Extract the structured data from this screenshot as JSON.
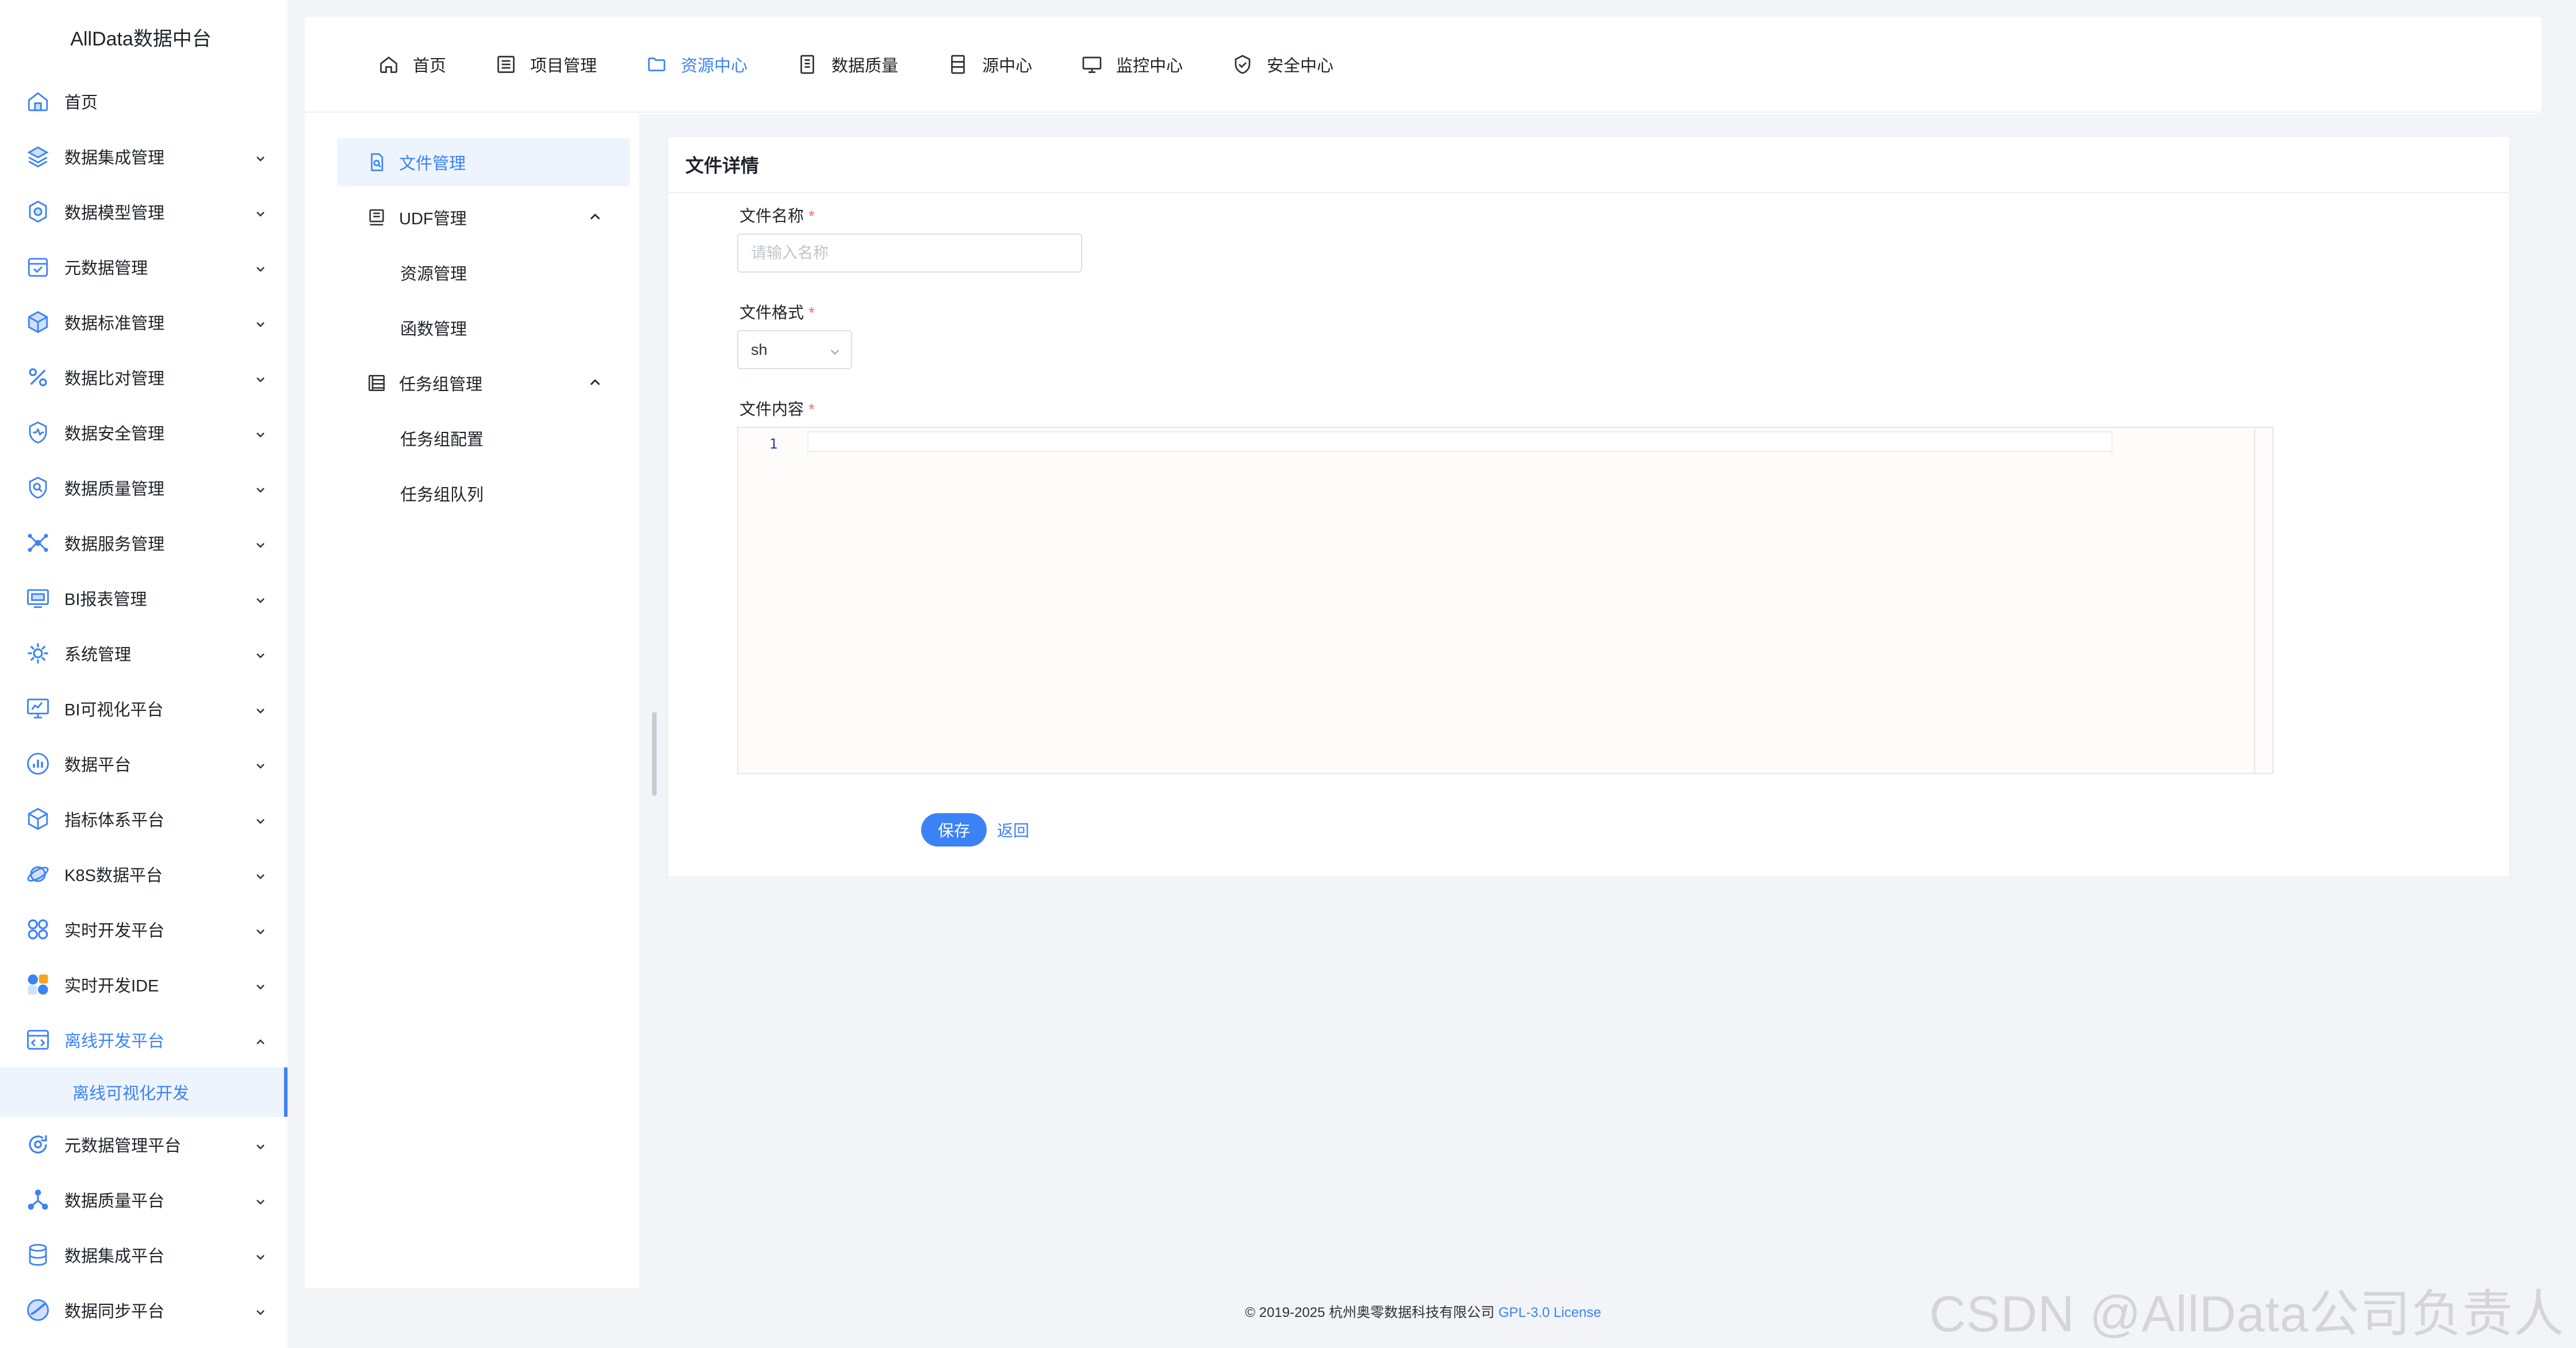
{
  "brand": "AllData数据中台",
  "sidebar": {
    "items": [
      {
        "label": "首页",
        "icon": "home-icon",
        "chevron": false
      },
      {
        "label": "数据集成管理",
        "icon": "layers-icon",
        "chevron": true
      },
      {
        "label": "数据模型管理",
        "icon": "gear-icon",
        "chevron": true
      },
      {
        "label": "元数据管理",
        "icon": "calendar-icon",
        "chevron": true
      },
      {
        "label": "数据标准管理",
        "icon": "cube-icon",
        "chevron": true
      },
      {
        "label": "数据比对管理",
        "icon": "percent-icon",
        "chevron": true
      },
      {
        "label": "数据安全管理",
        "icon": "shield-pulse-icon",
        "chevron": true
      },
      {
        "label": "数据质量管理",
        "icon": "quality-search-icon",
        "chevron": true
      },
      {
        "label": "数据服务管理",
        "icon": "network-icon",
        "chevron": true
      },
      {
        "label": "BI报表管理",
        "icon": "report-icon",
        "chevron": true
      },
      {
        "label": "系统管理",
        "icon": "system-gear-icon",
        "chevron": true
      },
      {
        "label": "BI可视化平台",
        "icon": "monitor-icon",
        "chevron": true
      },
      {
        "label": "数据平台",
        "icon": "chart-circle-icon",
        "chevron": true
      },
      {
        "label": "指标体系平台",
        "icon": "box-icon",
        "chevron": true
      },
      {
        "label": "K8S数据平台",
        "icon": "planet-icon",
        "chevron": true
      },
      {
        "label": "实时开发平台",
        "icon": "grid-circles-icon",
        "chevron": true
      },
      {
        "label": "实时开发IDE",
        "icon": "ide-icon",
        "chevron": true
      }
    ],
    "active_parent": {
      "label": "离线开发平台",
      "icon": "code-window-icon"
    },
    "active_child": "离线可视化开发",
    "items_after": [
      {
        "label": "元数据管理平台",
        "icon": "refresh-icon",
        "chevron": true
      },
      {
        "label": "数据质量平台",
        "icon": "nodes-icon",
        "chevron": true
      },
      {
        "label": "数据集成平台",
        "icon": "database-icon",
        "chevron": true
      },
      {
        "label": "数据同步平台",
        "icon": "sync-icon",
        "chevron": true
      }
    ]
  },
  "topnav": {
    "tabs": [
      {
        "label": "首页",
        "icon": "home-icon"
      },
      {
        "label": "项目管理",
        "icon": "list-icon"
      },
      {
        "label": "资源中心",
        "icon": "folder-icon",
        "active": true
      },
      {
        "label": "数据质量",
        "icon": "document-icon"
      },
      {
        "label": "源中心",
        "icon": "server-icon"
      },
      {
        "label": "监控中心",
        "icon": "monitor-icon"
      },
      {
        "label": "安全中心",
        "icon": "shield-check-icon"
      }
    ]
  },
  "leftnav": {
    "file_mgmt": "文件管理",
    "udf_mgmt": "UDF管理",
    "resource_mgmt": "资源管理",
    "function_mgmt": "函数管理",
    "task_group_mgmt": "任务组管理",
    "task_group_config": "任务组配置",
    "task_group_queue": "任务组队列"
  },
  "form": {
    "title": "文件详情",
    "name_label": "文件名称",
    "name_placeholder": "请输入名称",
    "name_value": "",
    "format_label": "文件格式",
    "format_value": "sh",
    "content_label": "文件内容",
    "required_mark": "*",
    "line_number": "1",
    "save_label": "保存",
    "back_label": "返回"
  },
  "footer": {
    "copyright": "© 2019-2025 杭州奥零数据科技有限公司",
    "license": "GPL-3.0 License"
  },
  "watermark": "CSDN @AllData公司负责人",
  "colors": {
    "accent": "#3b82f6",
    "required": "#f56c6c",
    "background": "#f3f4f8"
  }
}
